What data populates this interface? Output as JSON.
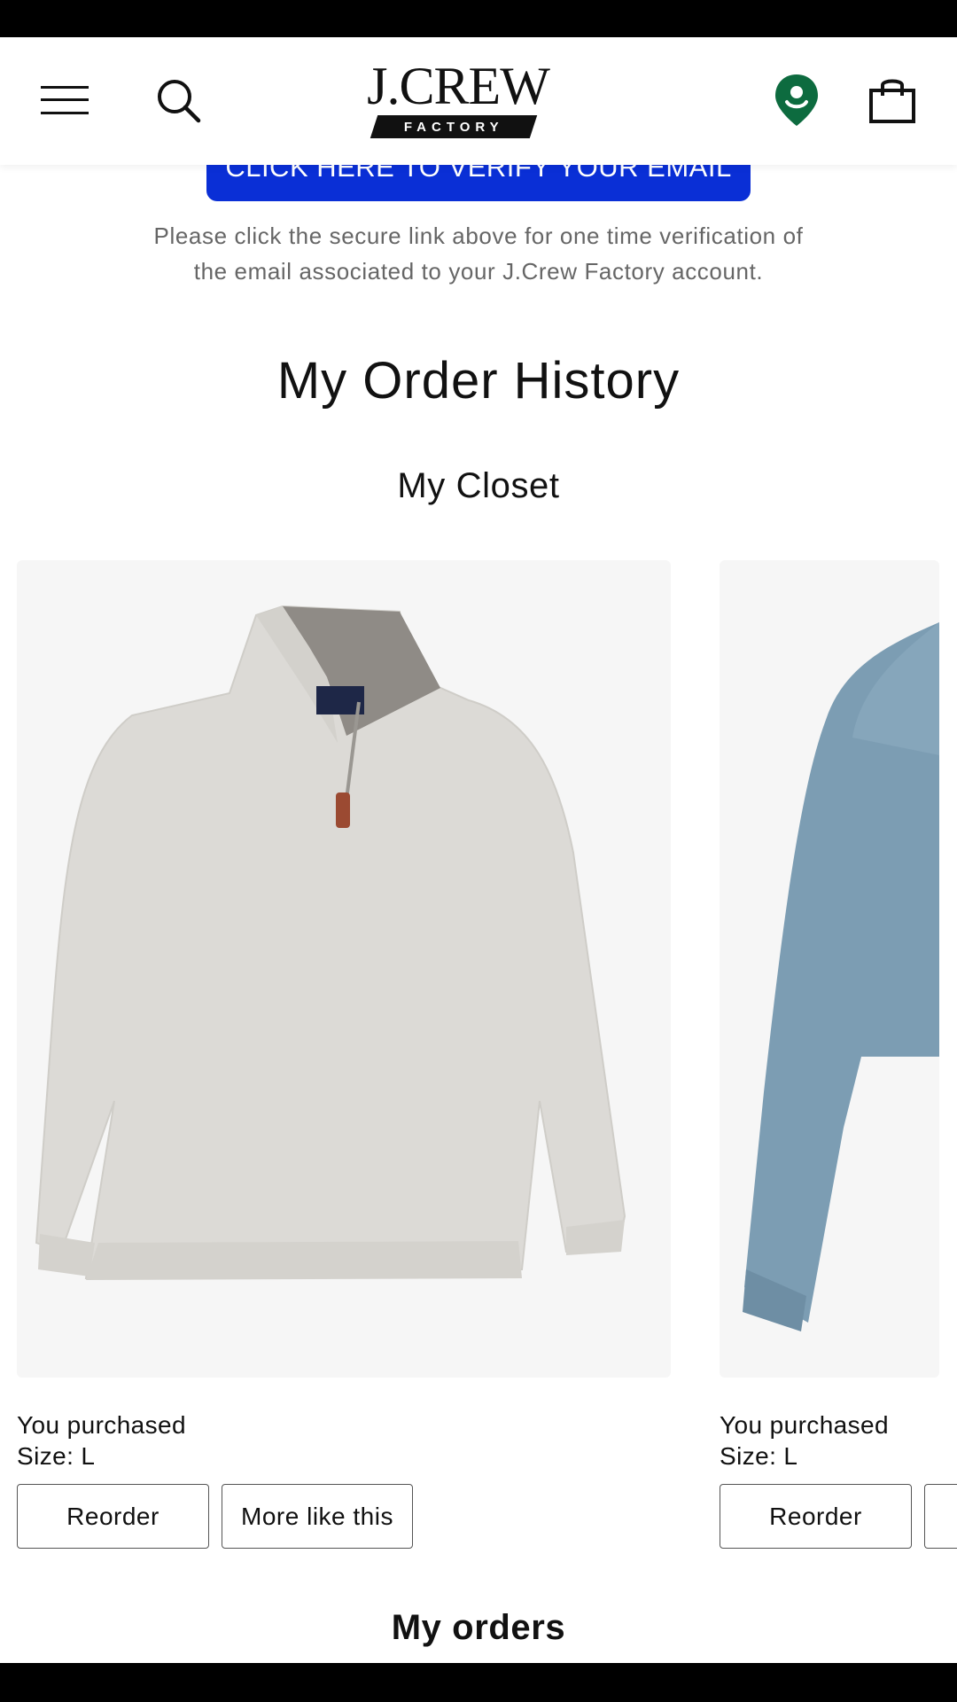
{
  "header": {
    "logo_text": "J.CREW",
    "logo_subtext": "FACTORY",
    "icons": {
      "menu": "hamburger-menu-icon",
      "search": "search-icon",
      "location": "location-pin-icon",
      "bag": "shopping-bag-icon"
    }
  },
  "verify": {
    "button_label": "CLICK HERE TO VERIFY YOUR EMAIL",
    "note_line1": "Please click the secure link above for one time verification of",
    "note_line2": "the email associated to your J.Crew Factory account."
  },
  "page_title": "My Order History",
  "closet": {
    "title": "My Closet",
    "items": [
      {
        "purchased_label": "You purchased",
        "size_label": "Size: L",
        "reorder_label": "Reorder",
        "more_label": "More like this",
        "image": "light-gray-half-zip-sweater"
      },
      {
        "purchased_label": "You purchased",
        "size_label": "Size: L",
        "reorder_label": "Reorder",
        "image": "blue-heather-sweater"
      }
    ]
  },
  "orders": {
    "title": "My orders"
  },
  "colors": {
    "accent_blue": "#0a2fd6",
    "location_green": "#0d6b3f",
    "image_background": "#f6f6f6"
  }
}
